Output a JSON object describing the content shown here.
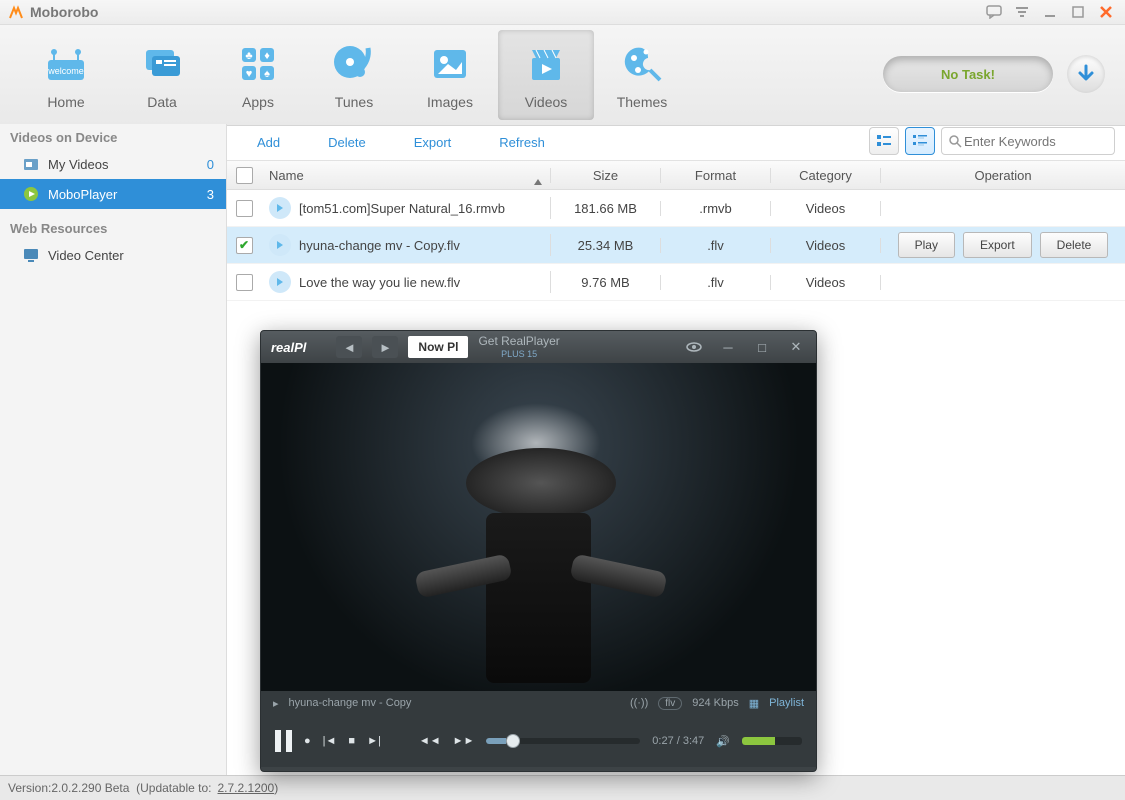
{
  "app": {
    "title": "Moborobo"
  },
  "window_controls": [
    "chat",
    "menu",
    "minimize",
    "maximize",
    "close"
  ],
  "toolbar": {
    "items": [
      {
        "id": "home",
        "label": "Home"
      },
      {
        "id": "data",
        "label": "Data"
      },
      {
        "id": "apps",
        "label": "Apps"
      },
      {
        "id": "tunes",
        "label": "Tunes"
      },
      {
        "id": "images",
        "label": "Images"
      },
      {
        "id": "videos",
        "label": "Videos",
        "active": true
      },
      {
        "id": "themes",
        "label": "Themes"
      }
    ],
    "notask_label": "No Task!"
  },
  "sidebar": {
    "section1": "Videos on Device",
    "items": [
      {
        "id": "myvideos",
        "label": "My Videos",
        "count": "0"
      },
      {
        "id": "moboplayer",
        "label": "MoboPlayer",
        "count": "3",
        "active": true
      }
    ],
    "section2": "Web Resources",
    "items2": [
      {
        "id": "videocenter",
        "label": "Video Center"
      }
    ]
  },
  "actions": {
    "add": "Add",
    "delete": "Delete",
    "export": "Export",
    "refresh": "Refresh"
  },
  "search": {
    "placeholder": "Enter Keywords"
  },
  "table": {
    "headers": {
      "name": "Name",
      "size": "Size",
      "format": "Format",
      "category": "Category",
      "operation": "Operation"
    },
    "rows": [
      {
        "checked": false,
        "name": "[tom51.com]Super Natural_16.rmvb",
        "size": "181.66 MB",
        "format": ".rmvb",
        "category": "Videos"
      },
      {
        "checked": true,
        "name": "hyuna-change mv - Copy.flv",
        "size": "25.34 MB",
        "format": ".flv",
        "category": "Videos",
        "selected": true,
        "ops": {
          "play": "Play",
          "export": "Export",
          "delete": "Delete"
        }
      },
      {
        "checked": false,
        "name": "Love the way you lie new.flv",
        "size": "9.76 MB",
        "format": ".flv",
        "category": "Videos"
      }
    ]
  },
  "player": {
    "brand": "realPl",
    "now": "Now Pl",
    "get": "Get RealPlayer",
    "get_sub": "PLUS 15",
    "track": "hyuna-change mv - Copy",
    "codec": "flv",
    "bitrate": "924 Kbps",
    "playlist": "Playlist",
    "time": "0:27 / 3:47"
  },
  "status": {
    "version_label": "Version: ",
    "version": "2.0.2.290 Beta",
    "update_prefix": "(Updatable to: ",
    "update_ver": "2.7.2.1200",
    "update_suffix": ")"
  },
  "colors": {
    "accent": "#2F8FD8",
    "green": "#7AA62E"
  }
}
